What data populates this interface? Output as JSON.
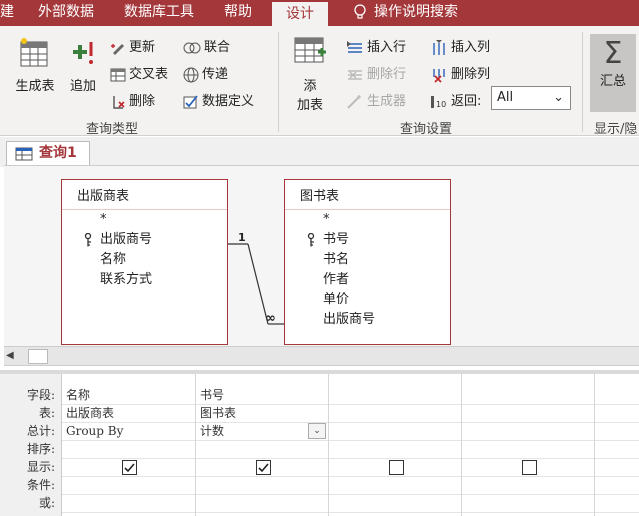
{
  "ribbon_tabs": [
    "建",
    "外部数据",
    "数据库工具",
    "帮助",
    "设计",
    "操作说明搜索"
  ],
  "ribbon": {
    "make_table": "生成表",
    "append": "追加",
    "update": "更新",
    "crosstab": "交叉表",
    "delete": "删除",
    "union": "联合",
    "pass_through": "传递",
    "data_definition": "数据定义",
    "query_type_label": "查询类型",
    "add_table_line1": "添",
    "add_table_line2": "加表",
    "insert_row": "插入行",
    "delete_row": "删除行",
    "builder": "生成器",
    "insert_col": "插入列",
    "delete_col": "删除列",
    "return_label": "返回:",
    "return_value": "All",
    "query_setup_label": "查询设置",
    "totals": "汇总",
    "show_hide_label": "显示/隐"
  },
  "document_tab": "查询1",
  "tables": [
    {
      "title": "出版商表",
      "fields": [
        "*",
        "出版商号",
        "名称",
        "联系方式"
      ],
      "key_field": 1
    },
    {
      "title": "图书表",
      "fields": [
        "*",
        "书号",
        "书名",
        "作者",
        "单价",
        "出版商号"
      ],
      "key_field": 1
    }
  ],
  "relationship": {
    "one_side": "1",
    "many_side": "∞"
  },
  "grid": {
    "row_labels": [
      "字段:",
      "表:",
      "总计:",
      "排序:",
      "显示:",
      "条件:",
      "或:"
    ],
    "columns": [
      {
        "field": "名称",
        "table": "出版商表",
        "total": "Group By",
        "show": true
      },
      {
        "field": "书号",
        "table": "图书表",
        "total": "计数",
        "show": true
      },
      {
        "field": "",
        "table": "",
        "total": "",
        "show": false
      },
      {
        "field": "",
        "table": "",
        "total": "",
        "show": false
      }
    ]
  },
  "colors": {
    "accent": "#a4373a"
  }
}
